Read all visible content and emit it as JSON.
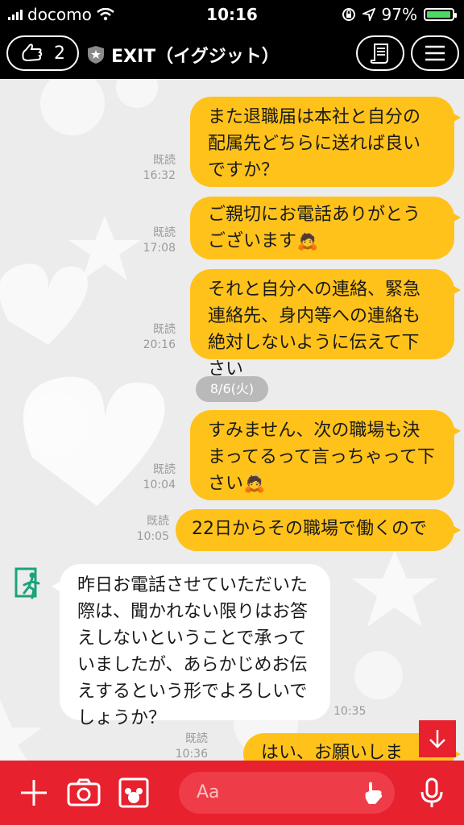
{
  "status_bar": {
    "carrier": "docomo",
    "time": "10:16",
    "battery": "97%",
    "battery_level": 0.97
  },
  "header": {
    "friends_count": "2",
    "title": "EXIT（イグジット）",
    "notes_icon": "notes-icon",
    "menu_icon": "menu-icon"
  },
  "messages": [
    {
      "dir": "out",
      "status": "既読",
      "time": "16:32",
      "text": "また退職届は本社と自分の配属先どちらに送れば良いですか？"
    },
    {
      "dir": "out",
      "status": "既読",
      "time": "17:08",
      "text": "ご親切にお電話ありがとうございます",
      "emoji": "🙇"
    },
    {
      "dir": "out",
      "status": "既読",
      "time": "20:16",
      "text": "それと自分への連絡、緊急連絡先、身内等への連絡も絶対しないように伝えて下さい"
    },
    {
      "dir": "out",
      "status": "既読",
      "time": "10:04",
      "text": "すみません、次の職場も決まってるって言っちゃって下さい",
      "emoji": "🙇"
    },
    {
      "dir": "out",
      "status": "既読",
      "time": "10:05",
      "text": "22日からその職場で働くので"
    },
    {
      "dir": "in",
      "time": "10:35",
      "text": "昨日お電話させていただいた際は、聞かれない限りはお答えしないということで承っていましたが、あらかじめお伝えするという形でよろしいでしょうか？"
    },
    {
      "dir": "out",
      "status": "既読",
      "time": "10:36",
      "text": "はい、お願いします！"
    }
  ],
  "date_separator": "8/6(火)",
  "input": {
    "placeholder": "Aa"
  },
  "colors": {
    "accent": "#e8212e",
    "bubble_out": "#ffc21b",
    "bubble_in": "#ffffff",
    "header": "#000000"
  }
}
